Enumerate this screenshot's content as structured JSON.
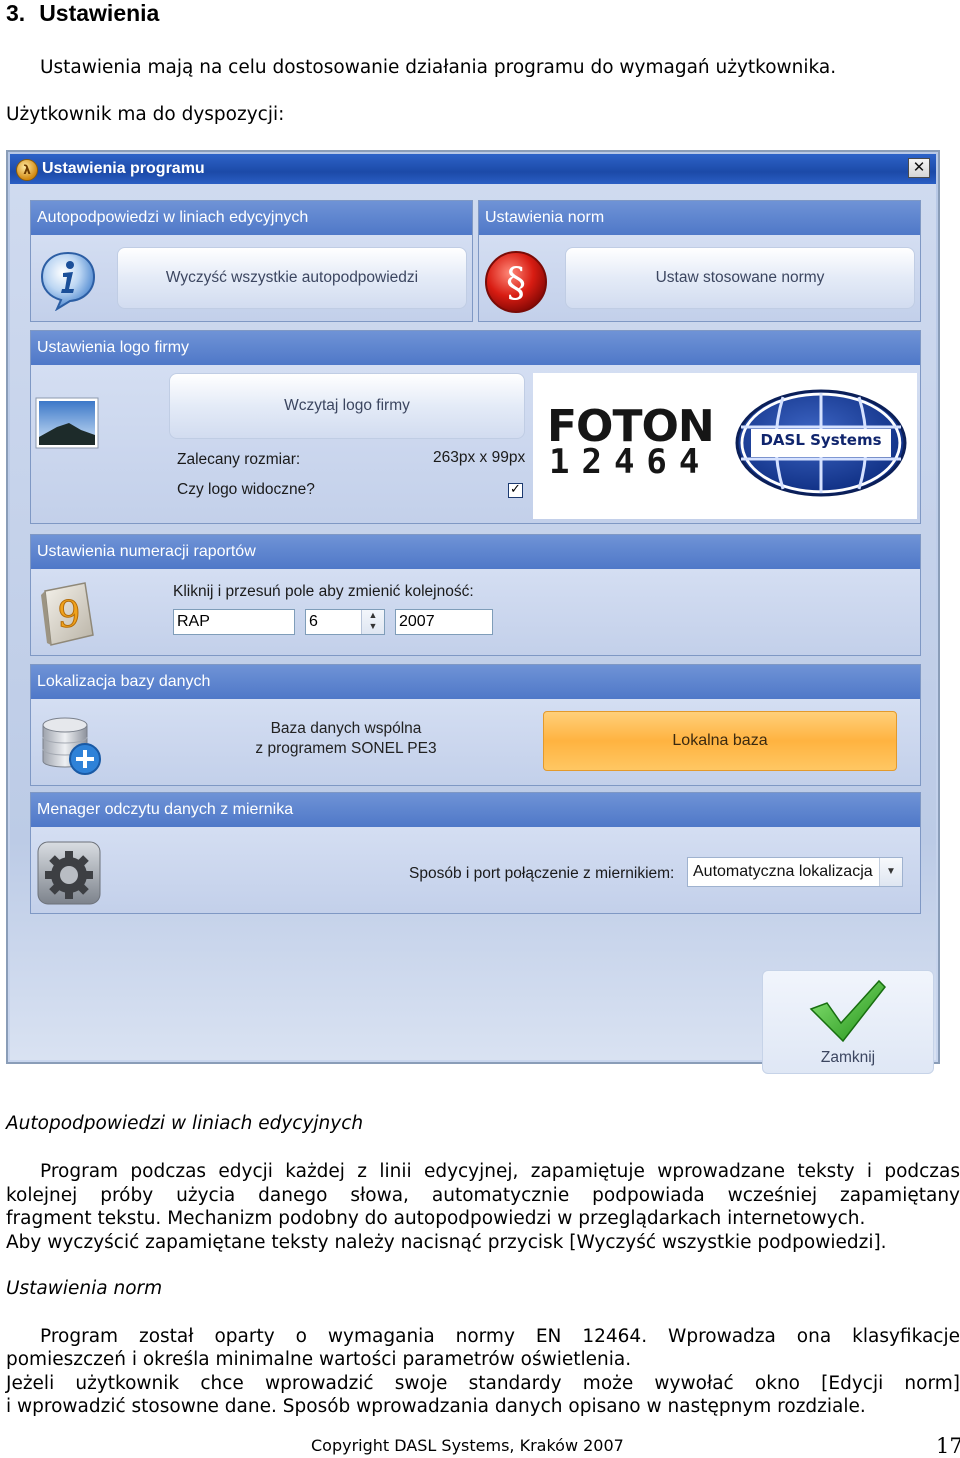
{
  "section": {
    "number": "3.",
    "title": "Ustawienia"
  },
  "intro": {
    "line1": "Ustawienia mają na celu dostosowanie działania programu do wymagań użytkownika.",
    "line2": "Użytkownik ma do dyspozycji:"
  },
  "window": {
    "title": "Ustawienia programu",
    "autopodpowiedzi": {
      "header": "Autopodpowiedzi w liniach edycyjnych",
      "clear_button": "Wyczyść wszystkie autopodpowiedzi"
    },
    "normy": {
      "header": "Ustawienia norm",
      "button": "Ustaw stosowane normy"
    },
    "logo": {
      "header": "Ustawienia logo firmy",
      "load_button": "Wczytaj logo firmy",
      "size_label": "Zalecany rozmiar:",
      "size_value": "263px x 99px",
      "visible_label": "Czy logo widoczne?",
      "visible_checked": true,
      "preview_brand": "FOTON",
      "preview_digits": "12464",
      "preview_badge": "DASL Systems"
    },
    "numeracja": {
      "header": "Ustawienia numeracji raportów",
      "instruction": "Kliknij i przesuń pole aby zmienić kolejność:",
      "field1": "RAP",
      "field2": "6",
      "field3": "2007",
      "icon_digit": "9"
    },
    "baza": {
      "header": "Lokalizacja bazy danych",
      "shared_line1": "Baza danych wspólna",
      "shared_line2": "z programem SONEL PE3",
      "local_button": "Lokalna baza"
    },
    "menager": {
      "header": "Menager odczytu danych z miernika",
      "connection_label": "Sposób i port połączenie z miernikiem:",
      "connection_value": "Automatyczna lokalizacja"
    },
    "close_button": "Zamknij"
  },
  "body": {
    "heading1": "Autopodpowiedzi w liniach edycyjnych",
    "p1_line1": "Program podczas edycji każdej z linii edycyjnej, zapamiętuje wprowadzane teksty i podczas",
    "p1_line2": "kolejnej próby użycia danego słowa, automatycznie podpowiada wcześniej zapamiętany",
    "p1_line3": "fragment tekstu. Mechanizm podobny do autopodpowiedzi w przeglądarkach internetowych.",
    "p1_line4": "Aby wyczyścić zapamiętane teksty należy nacisnąć przycisk [Wyczyść wszystkie podpowiedzi].",
    "heading2": "Ustawienia norm",
    "p2_line1": "Program został oparty o wymagania normy EN 12464. Wprowadza ona klasyfikacje",
    "p2_line2": "pomieszczeń i określa minimalne wartości parametrów oświetlenia.",
    "p2_line3": "Jeżeli użytkownik chce wprowadzić swoje standardy może wywołać okno [Edycji norm]",
    "p2_line4": "i wprowadzić stosowne dane. Sposób wprowadzania danych opisano w następnym rozdziale."
  },
  "footer": {
    "copyright": "Copyright DASL Systems, Kraków 2007",
    "page": "17"
  },
  "colors": {
    "title_bar": "#1c4aa8",
    "group_header": "#5a80cc",
    "accent_orange": "#ffb340",
    "check_green": "#2fb01e"
  }
}
